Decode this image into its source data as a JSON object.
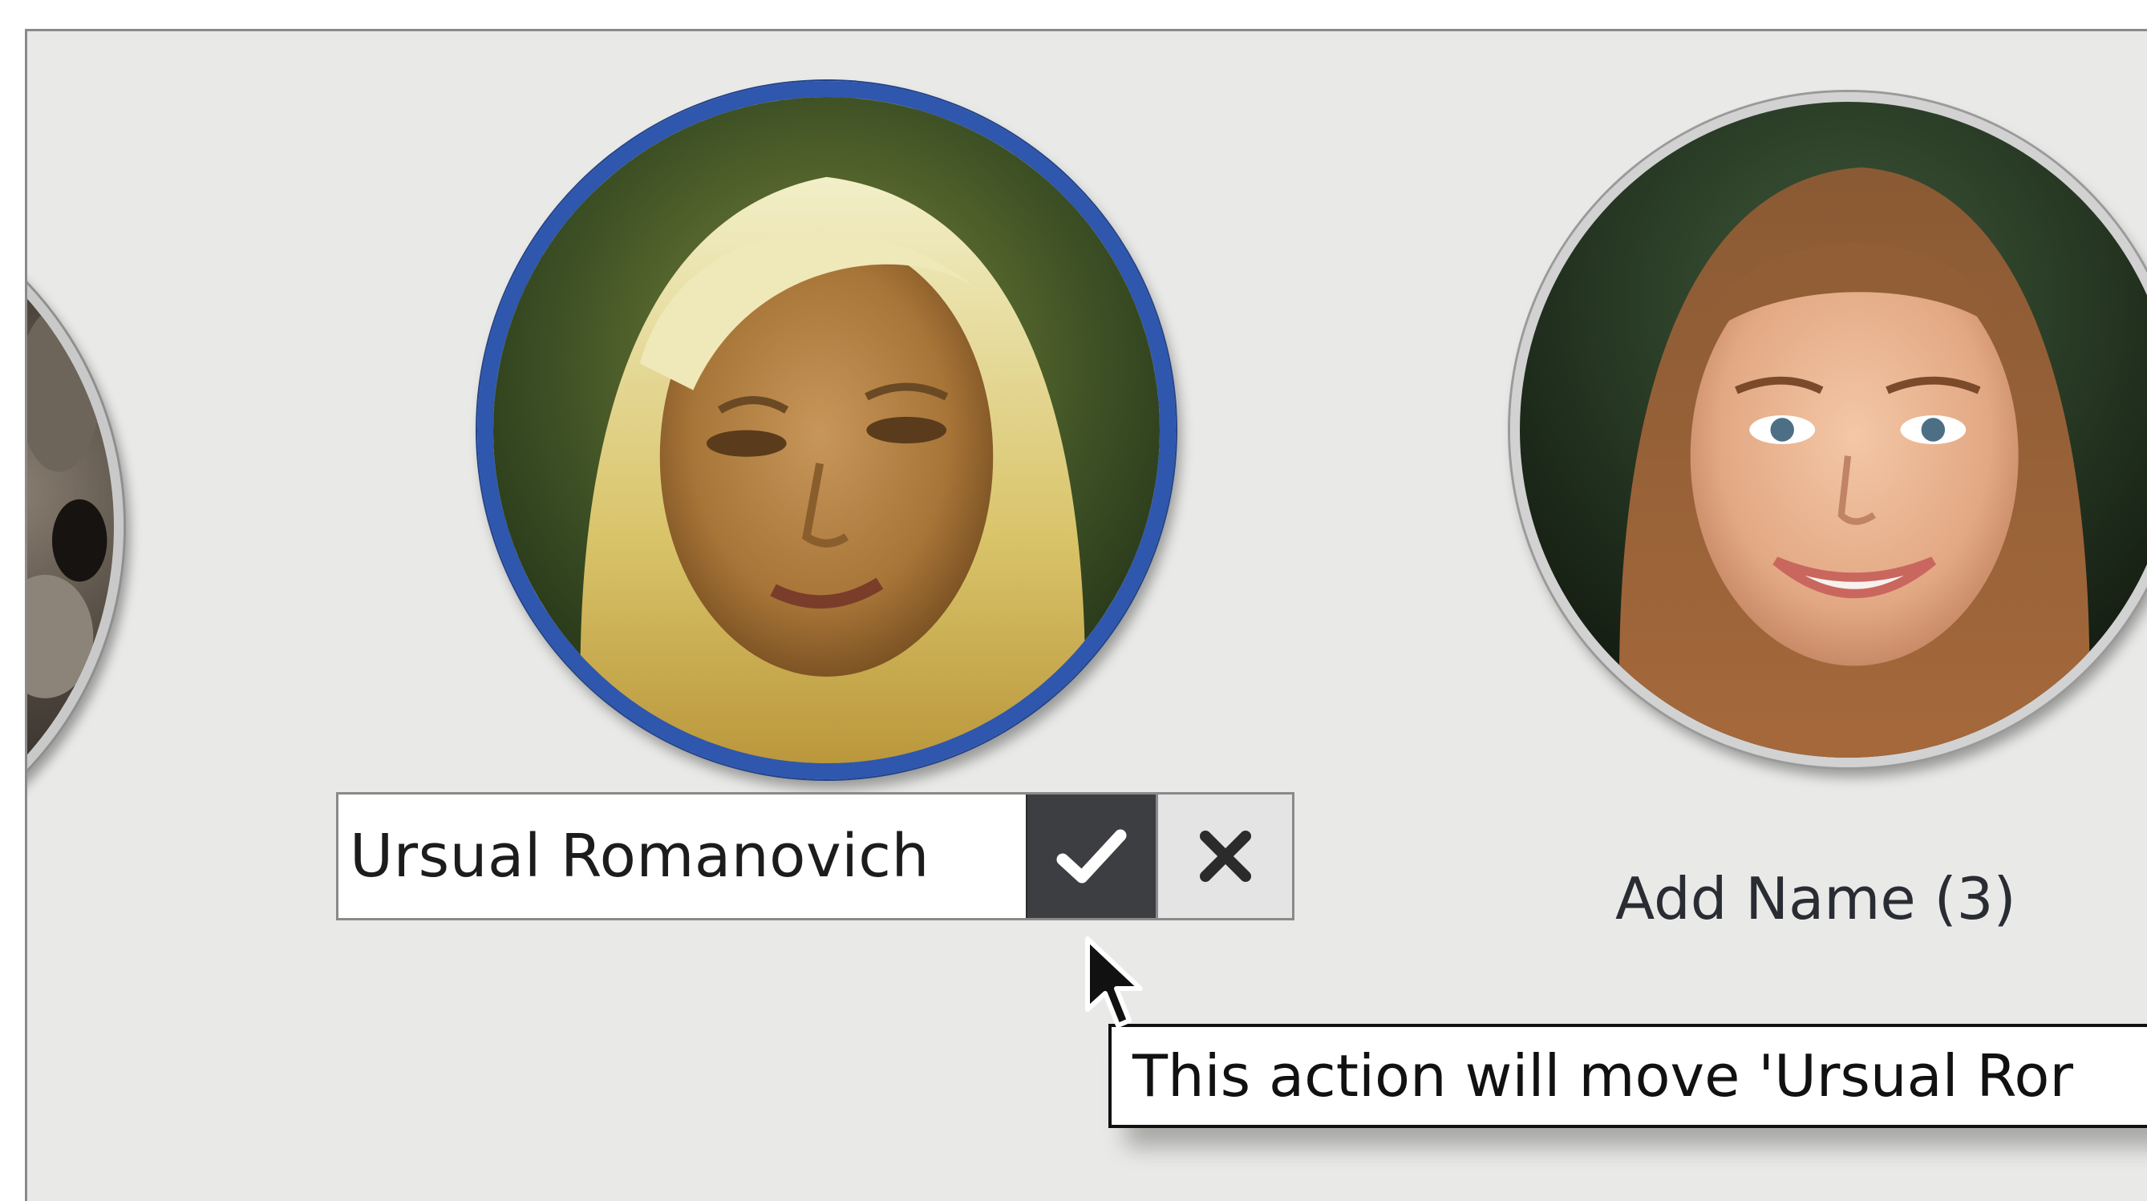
{
  "name_editor": {
    "value": "Ursual Romanovich",
    "confirm_icon": "checkmark-icon",
    "cancel_icon": "close-icon"
  },
  "unnamed_face": {
    "label": "Add Name (3)"
  },
  "tooltip": {
    "text": "This action will move 'Ursual Ror"
  },
  "colors": {
    "selection_ring": "#2e57ad",
    "panel_background": "#e9e9e7",
    "confirm_button": "#3d3e41"
  }
}
